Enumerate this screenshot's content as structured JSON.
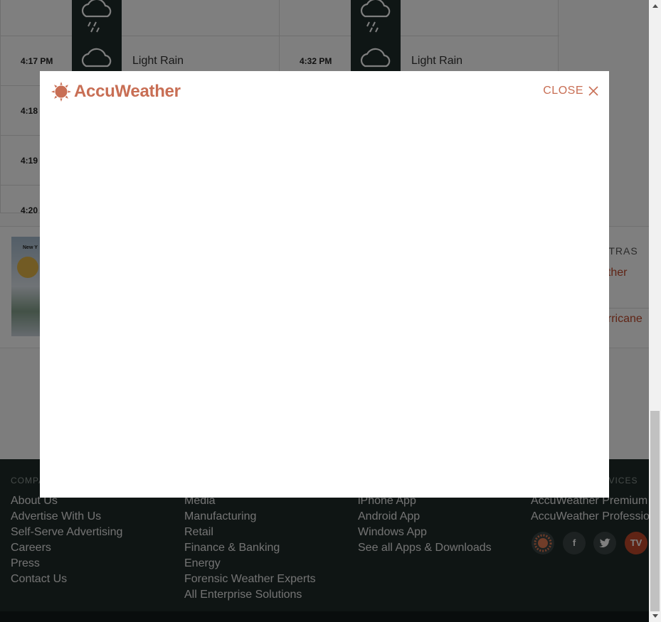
{
  "minutecast": {
    "rows": [
      {
        "left_time": "",
        "left_condition": "",
        "right_time": "",
        "right_condition": ""
      },
      {
        "left_time": "4:17 PM",
        "left_condition": "Light Rain",
        "right_time": "4:32 PM",
        "right_condition": "Light Rain"
      },
      {
        "left_time": "4:18",
        "left_condition": "",
        "right_time": "",
        "right_condition": ""
      },
      {
        "left_time": "4:19",
        "left_condition": "",
        "right_time": "",
        "right_condition": ""
      },
      {
        "left_time": "4:20",
        "left_condition": "",
        "right_time": "",
        "right_condition": ""
      }
    ],
    "icon": "rain-cloud-icon"
  },
  "news": {
    "thumbnail_caption": "New Y",
    "extras_title": "XTRAS",
    "extras_links": [
      "ather",
      "urricane"
    ]
  },
  "footer": {
    "columns": [
      {
        "heading": "COMPA",
        "links": [
          "About Us",
          "Advertise With Us",
          "Self-Serve Advertising",
          "Careers",
          "Press",
          "Contact Us"
        ]
      },
      {
        "heading": "",
        "links": [
          "Media",
          "Manufacturing",
          "Retail",
          "Finance & Banking",
          "Energy",
          "Forensic Weather Experts",
          "All Enterprise Solutions"
        ]
      },
      {
        "heading": "",
        "links": [
          "iPhone App",
          "Android App",
          "Windows App",
          "See all Apps & Downloads"
        ]
      },
      {
        "heading": "RVICES",
        "links": [
          "AccuWeather Premium",
          "AccuWeather Professio"
        ]
      }
    ],
    "social": [
      {
        "name": "accuweather-social-icon",
        "label": ""
      },
      {
        "name": "facebook-icon",
        "label": "f"
      },
      {
        "name": "twitter-icon",
        "label": ""
      },
      {
        "name": "tv-icon",
        "label": "TV"
      }
    ]
  },
  "modal": {
    "logo_text": "AccuWeather",
    "close_label": "CLOSE",
    "brand_color": "#c86e54"
  }
}
